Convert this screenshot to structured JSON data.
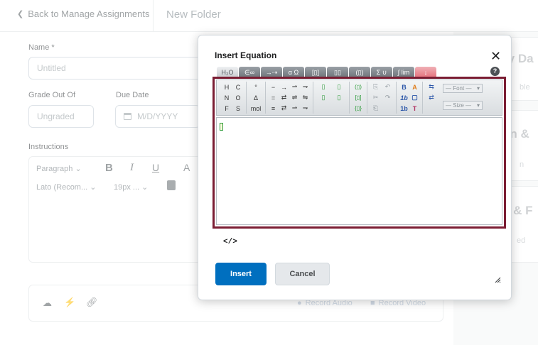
{
  "topbar": {
    "back_label": "Back to Manage Assignments",
    "title": "New Folder"
  },
  "form": {
    "name_label": "Name *",
    "name_placeholder": "Untitled",
    "grade_label": "Grade Out Of",
    "grade_placeholder": "Ungraded",
    "due_label": "Due Date",
    "due_placeholder": "M/D/YYYY",
    "instructions_label": "Instructions",
    "editor": {
      "paragraph": "Paragraph",
      "font": "Lato (Recom...",
      "size": "19px ..."
    }
  },
  "attachments": {
    "record_audio": "Record Audio",
    "record_video": "Record Video"
  },
  "right_panel": {
    "cards": [
      {
        "title": "ty Da",
        "sub": "ble"
      },
      {
        "title": "on &",
        "sub": "n"
      },
      {
        "title": "n & F",
        "sub": "ed"
      }
    ]
  },
  "dialog": {
    "title": "Insert Equation",
    "tabs": [
      "H₂O",
      "∈∞",
      "→⇢",
      "α Ω",
      "[▯]",
      "▯▯",
      "(▯)",
      "Σ ∪",
      "∫ lim",
      "↓"
    ],
    "toolbar": {
      "group1": [
        "H",
        "N",
        "F",
        "C",
        "O",
        "S"
      ],
      "group2": [
        "°",
        "Δ",
        "mol"
      ],
      "group3": [
        "−",
        "=",
        "≡",
        "→",
        "⇄",
        "⇄",
        "⇀",
        "⇌",
        "⇀",
        "⇁",
        "⇋",
        "⇁"
      ],
      "group4": [
        "▯",
        "▯",
        "▯",
        "▯"
      ],
      "group5": [
        "(▯)",
        "[▯]",
        "{▯}"
      ],
      "group6": [
        "⎘",
        "✂",
        "⎗",
        "↶",
        "↷"
      ],
      "group7": [
        "B",
        "1b",
        "1b",
        "A",
        "▢",
        "T"
      ],
      "group8": [
        "⇆",
        "⇄"
      ],
      "font_select": "— Font —",
      "size_select": "— Size —"
    },
    "source_toggle": "</>",
    "insert_label": "Insert",
    "cancel_label": "Cancel",
    "help_label": "?",
    "close_label": "✕"
  }
}
